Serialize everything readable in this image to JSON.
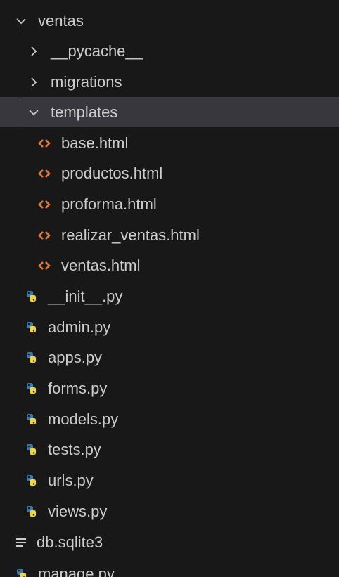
{
  "explorer": {
    "root_folder": "ventas",
    "items": [
      {
        "label": "__pycache__",
        "type": "folder",
        "state": "collapsed"
      },
      {
        "label": "migrations",
        "type": "folder",
        "state": "collapsed"
      },
      {
        "label": "templates",
        "type": "folder",
        "state": "expanded",
        "selected": true
      },
      {
        "label": "base.html",
        "type": "html-file"
      },
      {
        "label": "productos.html",
        "type": "html-file"
      },
      {
        "label": "proforma.html",
        "type": "html-file"
      },
      {
        "label": "realizar_ventas.html",
        "type": "html-file"
      },
      {
        "label": "ventas.html",
        "type": "html-file"
      },
      {
        "label": "__init__.py",
        "type": "python-file"
      },
      {
        "label": "admin.py",
        "type": "python-file"
      },
      {
        "label": "apps.py",
        "type": "python-file"
      },
      {
        "label": "forms.py",
        "type": "python-file"
      },
      {
        "label": "models.py",
        "type": "python-file"
      },
      {
        "label": "tests.py",
        "type": "python-file"
      },
      {
        "label": "urls.py",
        "type": "python-file"
      },
      {
        "label": "views.py",
        "type": "python-file"
      },
      {
        "label": "db.sqlite3",
        "type": "database-file"
      },
      {
        "label": "manage.py",
        "type": "python-file"
      }
    ]
  },
  "colors": {
    "background": "#181818",
    "selected_row": "#37373d",
    "text": "#cccccc",
    "html_icon": "#e37933",
    "python_blue": "#3b78a8",
    "python_yellow": "#f0d445"
  },
  "icons": {
    "folder_collapsed": "chevron-right-icon",
    "folder_expanded": "chevron-down-icon",
    "html_file": "html-file-icon",
    "python_file": "python-file-icon",
    "database_file": "database-file-icon"
  }
}
